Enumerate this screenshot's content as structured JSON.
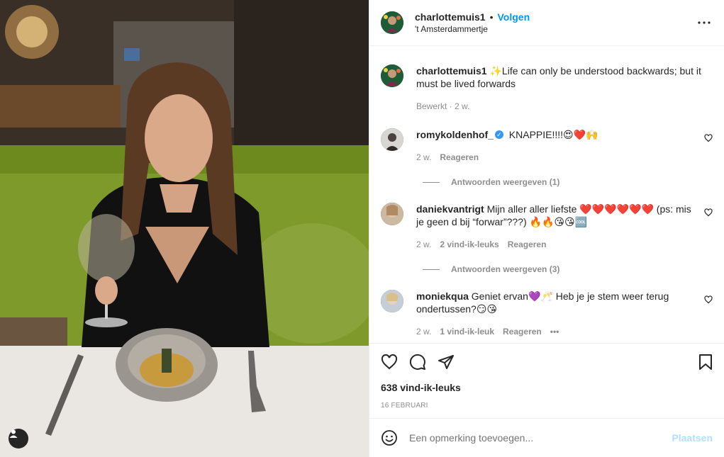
{
  "post": {
    "username": "charlottemuis1",
    "follow_label": "Volgen",
    "location": "'t Amsterdammertje",
    "caption": "✨Life can only be understood backwards; but it must be lived forwards",
    "caption_meta": "Bewerkt · 2 w."
  },
  "comments": [
    {
      "username": "romykoldenhof_",
      "verified": true,
      "text": "KNAPPIE!!!!😍❤️🙌",
      "time": "2 w.",
      "likes": "",
      "reply_label": "Reageren",
      "replies_label": "Antwoorden weergeven (1)"
    },
    {
      "username": "daniekvantrigt",
      "text": "Mijn aller aller liefste ❤️❤️❤️❤️❤️❤️ (ps: mis je geen d bij “forwar”???) 🔥🔥😘😘🆒",
      "time": "2 w.",
      "likes": "2 vind-ik-leuks",
      "reply_label": "Reageren",
      "replies_label": "Antwoorden weergeven (3)"
    },
    {
      "username": "moniekqua",
      "text": "Geniet ervan💜🥂 Heb je je stem weer terug ondertussen?😏😘",
      "time": "2 w.",
      "likes": "1 vind-ik-leuk",
      "reply_label": "Reageren",
      "more": "•••"
    }
  ],
  "likes_count": "638 vind-ik-leuks",
  "date": "16 FEBRUARI",
  "add_comment": {
    "placeholder": "Een opmerking toevoegen...",
    "post_label": "Plaatsen"
  },
  "icons": {
    "like": "heart-icon",
    "comment": "comment-icon",
    "share": "paper-plane-icon",
    "save": "bookmark-icon",
    "more": "more-icon",
    "emoji": "emoji-icon",
    "tag": "user-tag-icon"
  }
}
